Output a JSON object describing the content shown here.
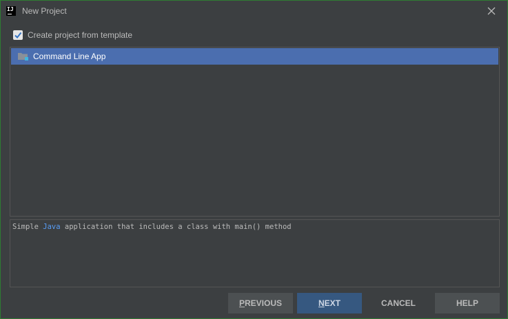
{
  "window": {
    "title": "New Project",
    "app_icon_text": "IJ"
  },
  "options": {
    "template_checkbox_label": "Create project from template",
    "template_checkbox_checked": true
  },
  "templates": {
    "items": [
      {
        "label": "Command Line App",
        "selected": true,
        "icon": "folder-icon"
      }
    ]
  },
  "description": {
    "prefix": "Simple ",
    "highlight": "Java",
    "suffix": " application that includes a class with main() method"
  },
  "buttons": {
    "previous": {
      "first": "P",
      "rest": "REVIOUS"
    },
    "next": {
      "first": "N",
      "rest": "EXT"
    },
    "cancel": "CANCEL",
    "help": "HELP"
  },
  "colors": {
    "background": "#3c3f41",
    "selection": "#4b6eaf",
    "primary_button": "#365880",
    "java_highlight": "#589df6",
    "window_border": "#2e7d32"
  }
}
